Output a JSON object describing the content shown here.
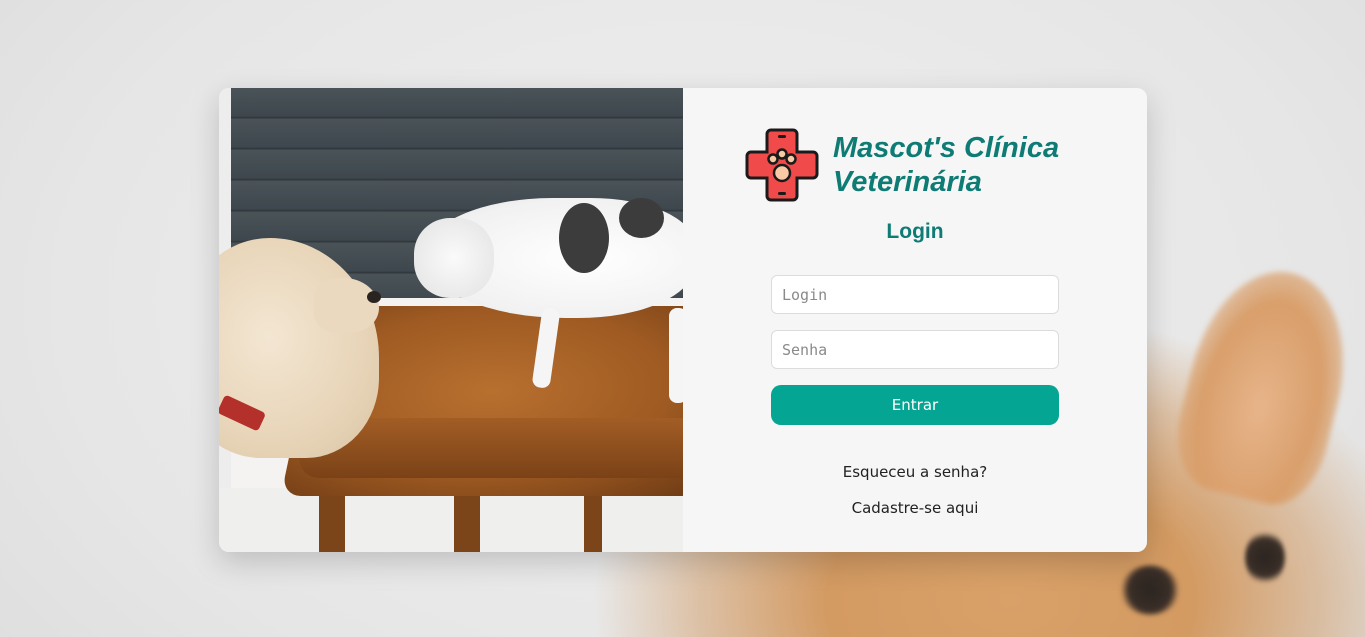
{
  "brand": {
    "name_line1": "Mascot's Clínica",
    "name_line2": "Veterinária",
    "logo_icon": "paw-cross-icon",
    "accent_color": "#0e7b74",
    "logo_color": "#f04a4a"
  },
  "login": {
    "title": "Login",
    "login_placeholder": "Login",
    "password_placeholder": "Senha",
    "submit_label": "Entrar",
    "submit_color": "#05a593",
    "forgot_link": "Esqueceu a senha?",
    "signup_link": "Cadastre-se aqui"
  }
}
